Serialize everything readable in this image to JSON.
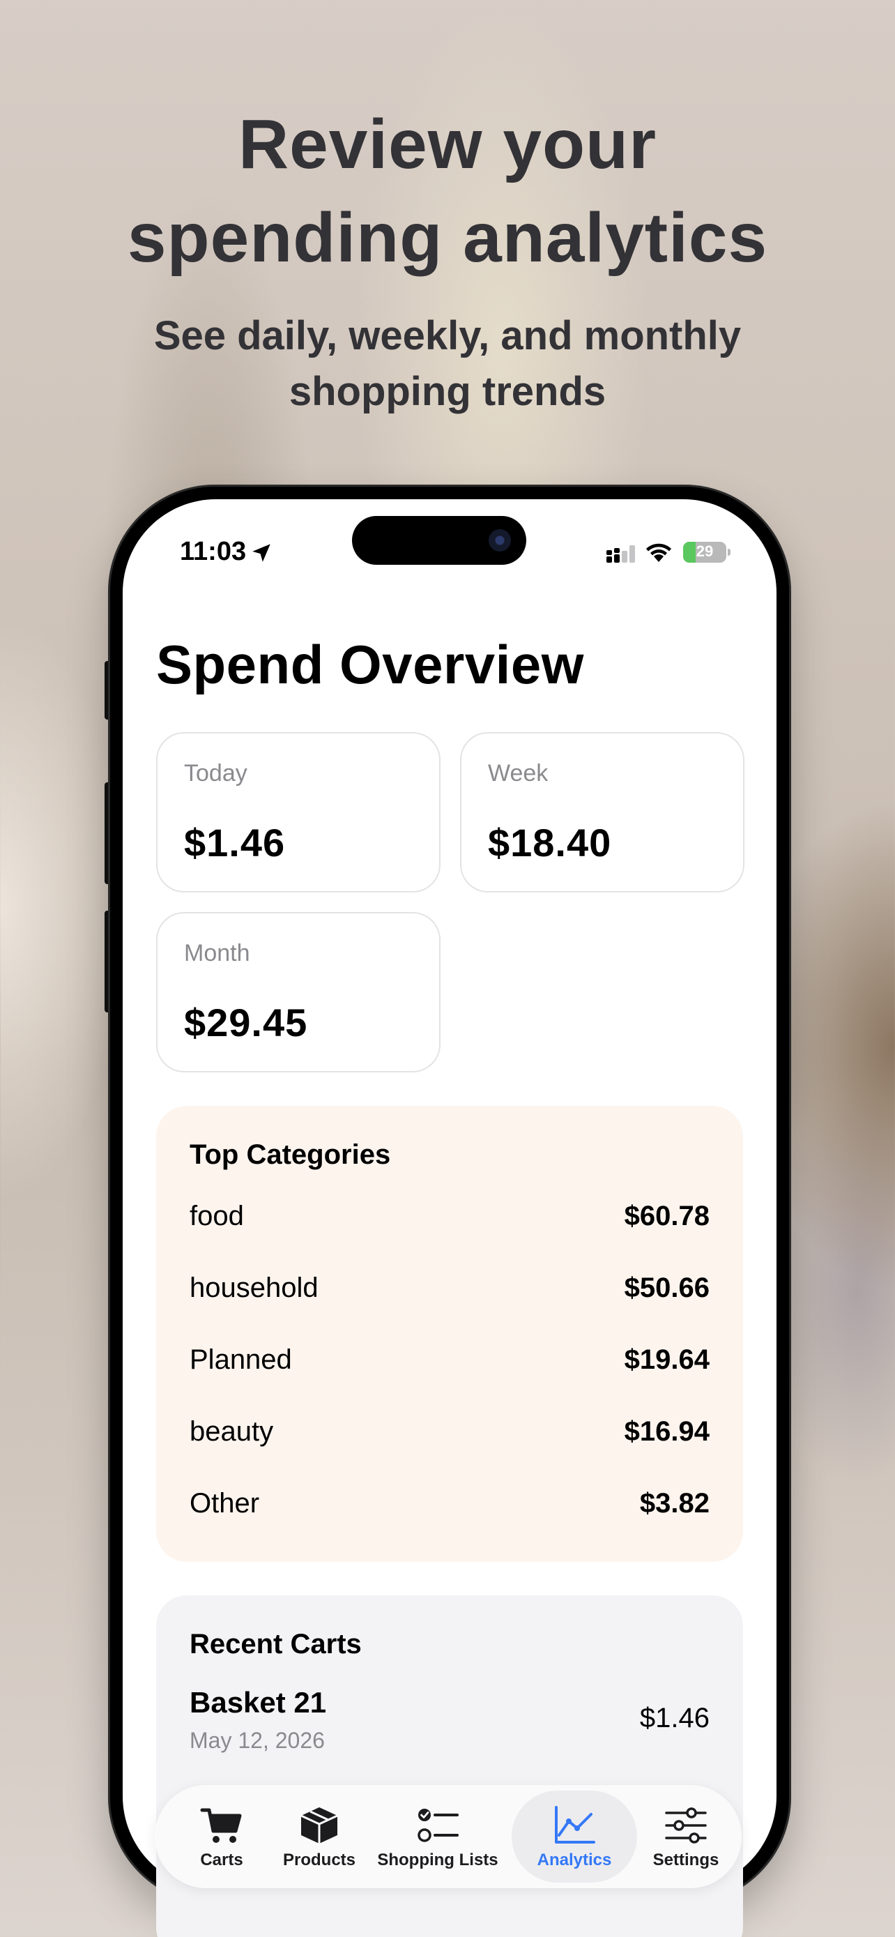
{
  "promo": {
    "headline_line1": "Review your",
    "headline_line2": "spending analytics",
    "subline_line1": "See daily, weekly, and monthly",
    "subline_line2": "shopping trends"
  },
  "status_bar": {
    "time": "11:03",
    "battery": "29",
    "battery_level": 0.29,
    "battery_color": "#5ac85f",
    "icons": [
      "location-arrow-icon",
      "cellular-signal-icon",
      "wifi-icon",
      "battery-charging-icon"
    ]
  },
  "overview": {
    "title": "Spend Overview",
    "stats": [
      {
        "label": "Today",
        "value": "$1.46"
      },
      {
        "label": "Week",
        "value": "$18.40"
      },
      {
        "label": "Month",
        "value": "$29.45"
      }
    ]
  },
  "top_categories": {
    "title": "Top Categories",
    "background": "#fdf4ee",
    "items": [
      {
        "name": "food",
        "amount": "$60.78"
      },
      {
        "name": "household",
        "amount": "$50.66"
      },
      {
        "name": "Planned",
        "amount": "$19.64"
      },
      {
        "name": "beauty",
        "amount": "$16.94"
      },
      {
        "name": "Other",
        "amount": "$3.82"
      }
    ]
  },
  "recent_carts": {
    "title": "Recent Carts",
    "items": [
      {
        "name": "Basket 21",
        "date": "May 12, 2026",
        "amount": "$1.46"
      }
    ]
  },
  "tabbar": {
    "accent": "#3478f6",
    "tabs": [
      {
        "label": "Carts",
        "icon": "cart-icon",
        "active": false
      },
      {
        "label": "Products",
        "icon": "box-icon",
        "active": false
      },
      {
        "label": "Shopping Lists",
        "icon": "checklist-icon",
        "active": false
      },
      {
        "label": "Analytics",
        "icon": "chart-line-icon",
        "active": true
      },
      {
        "label": "Settings",
        "icon": "sliders-icon",
        "active": false
      }
    ]
  }
}
